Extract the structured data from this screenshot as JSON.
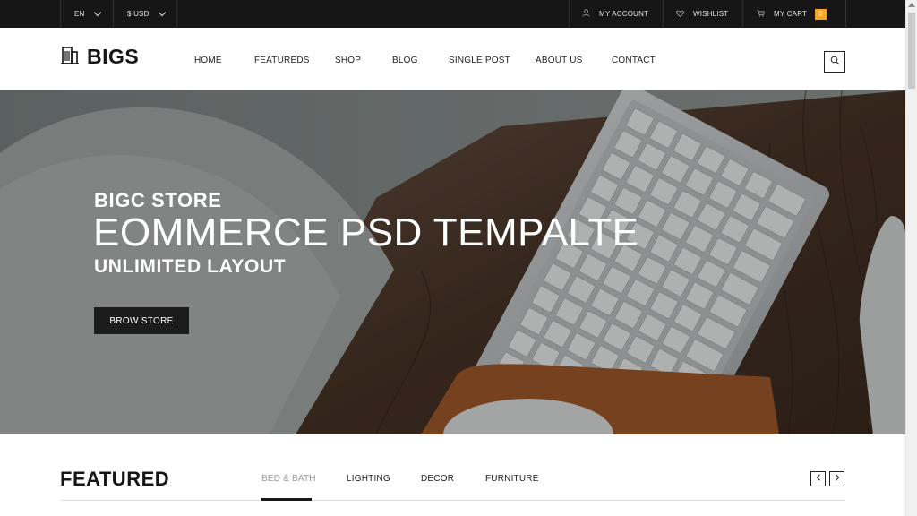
{
  "topbar": {
    "language": "EN",
    "currency": "$ USD",
    "account": "MY ACCOUNT",
    "wishlist": "WISHLIST",
    "cart": "MY CART",
    "cart_count": "0"
  },
  "header": {
    "logo": "BIGS",
    "nav": [
      "HOME",
      "FEATUREDS",
      "SHOP",
      "BLOG",
      "SINGLE POST",
      "ABOUT US",
      "CONTACT"
    ]
  },
  "hero": {
    "subtitle": "BIGC STORE",
    "title": "EOMMERCE PSD TEMPALTE",
    "subtitle2": "UNLIMITED LAYOUT",
    "button": "BROW STORE"
  },
  "featured": {
    "title": "FEATURED",
    "tabs": [
      "BED & BATH",
      "LIGHTING",
      "DECOR",
      "FURNITURE"
    ],
    "active_tab": "BED & BATH"
  },
  "colors": {
    "topbar_bg": "#161616",
    "accent": "#f5a623",
    "button_bg": "#1c1c1c"
  }
}
